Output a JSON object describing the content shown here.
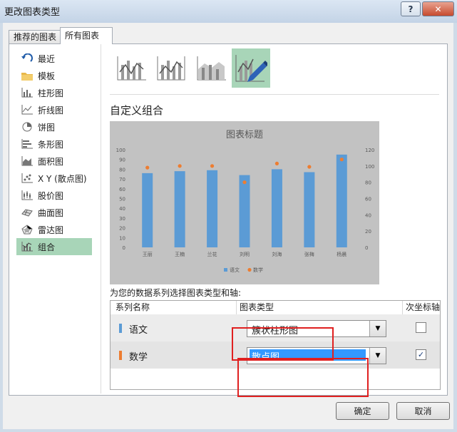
{
  "window": {
    "title": "更改图表类型",
    "help_label": "?",
    "close_label": "✕"
  },
  "tabs": [
    {
      "label": "推荐的图表"
    },
    {
      "label": "所有图表"
    }
  ],
  "nav": [
    {
      "label": "最近",
      "icon": "recent-icon"
    },
    {
      "label": "模板",
      "icon": "folder-icon"
    },
    {
      "label": "柱形图",
      "icon": "column-chart-icon"
    },
    {
      "label": "折线图",
      "icon": "line-chart-icon"
    },
    {
      "label": "饼图",
      "icon": "pie-chart-icon"
    },
    {
      "label": "条形图",
      "icon": "bar-chart-icon"
    },
    {
      "label": "面积图",
      "icon": "area-chart-icon"
    },
    {
      "label": "X Y (散点图)",
      "icon": "scatter-chart-icon"
    },
    {
      "label": "股价图",
      "icon": "stock-chart-icon"
    },
    {
      "label": "曲面图",
      "icon": "surface-chart-icon"
    },
    {
      "label": "雷达图",
      "icon": "radar-chart-icon"
    },
    {
      "label": "组合",
      "icon": "combo-chart-icon",
      "selected": true
    }
  ],
  "section_title": "自定义组合",
  "prompt": "为您的数据系列选择图表类型和轴:",
  "colors": {
    "series1": "#5b9bd5",
    "series2": "#ed7d31",
    "selection": "#a8d5b8",
    "highlight": "#e02020"
  },
  "chart_data": {
    "type": "bar",
    "title": "图表标题",
    "categories": [
      "王丽",
      "王楠",
      "兰花",
      "刘明",
      "刘海",
      "张梅",
      "杨晨"
    ],
    "series": [
      {
        "name": "语文",
        "type": "bar",
        "axis": "primary",
        "values": [
          76,
          78,
          79,
          74,
          80,
          77,
          95
        ]
      },
      {
        "name": "数学",
        "type": "scatter",
        "axis": "secondary",
        "values": [
          98,
          100,
          100,
          80,
          103,
          99,
          108
        ]
      }
    ],
    "y_primary": {
      "range": [
        0,
        100
      ],
      "ticks": [
        "0",
        "10",
        "20",
        "30",
        "40",
        "50",
        "60",
        "70",
        "80",
        "90",
        "100"
      ]
    },
    "y_secondary": {
      "range": [
        0,
        120
      ],
      "ticks": [
        "0",
        "20",
        "40",
        "60",
        "80",
        "100",
        "120"
      ]
    },
    "legend": "bottom",
    "grid": false
  },
  "grid": {
    "headers": {
      "name": "系列名称",
      "type": "图表类型",
      "secondary": "次坐标轴"
    },
    "rows": [
      {
        "name": "语文",
        "chart_type": "簇状柱形图",
        "secondary_axis": false
      },
      {
        "name": "数学",
        "chart_type": "散点图",
        "secondary_axis": true
      }
    ],
    "check_mark": "✓"
  },
  "buttons": {
    "ok": "确定",
    "cancel": "取消"
  }
}
